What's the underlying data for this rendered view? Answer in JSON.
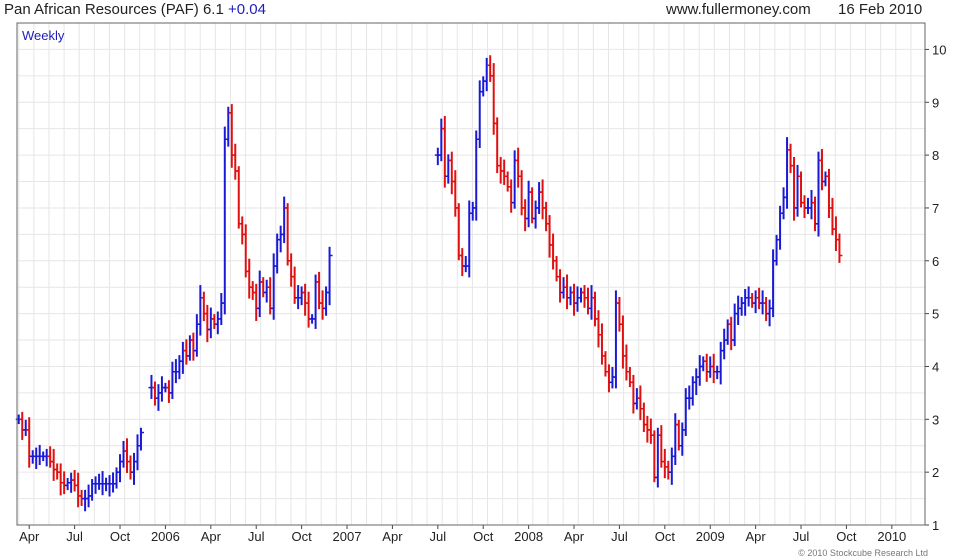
{
  "header": {
    "name": "Pan African Resources (PAF)",
    "price": "6.1",
    "change": "+0.04",
    "source": "www.fullermoney.com",
    "date": "16 Feb 2010"
  },
  "chart_data": {
    "type": "ohlc",
    "period_label": "Weekly",
    "ylim": [
      1,
      10.5
    ],
    "yticks": [
      1,
      2,
      3,
      4,
      5,
      6,
      7,
      8,
      9,
      10
    ],
    "grid": true,
    "up_color": "#1a1ad6",
    "down_color": "#e01010",
    "xticks": [
      {
        "label": "Apr",
        "x": 3
      },
      {
        "label": "Jul",
        "x": 16
      },
      {
        "label": "Oct",
        "x": 29
      },
      {
        "label": "2006",
        "x": 42
      },
      {
        "label": "Apr",
        "x": 55
      },
      {
        "label": "Jul",
        "x": 68
      },
      {
        "label": "Oct",
        "x": 81
      },
      {
        "label": "2007",
        "x": 94
      },
      {
        "label": "Apr",
        "x": 107
      },
      {
        "label": "Jul",
        "x": 120
      },
      {
        "label": "Oct",
        "x": 133
      },
      {
        "label": "2008",
        "x": 146
      },
      {
        "label": "Apr",
        "x": 159
      },
      {
        "label": "Jul",
        "x": 172
      },
      {
        "label": "Oct",
        "x": 185
      },
      {
        "label": "2009",
        "x": 198
      },
      {
        "label": "Apr",
        "x": 211
      },
      {
        "label": "Jul",
        "x": 224
      },
      {
        "label": "Oct",
        "x": 237
      },
      {
        "label": "2010",
        "x": 250
      }
    ],
    "x_range": [
      0,
      259
    ],
    "closes": [
      {
        "x": 0,
        "c": 3.0
      },
      {
        "x": 1,
        "c": 2.8
      },
      {
        "x": 2,
        "c": 2.8
      },
      {
        "x": 3,
        "c": 2.3
      },
      {
        "x": 4,
        "c": 2.3
      },
      {
        "x": 5,
        "c": 2.3
      },
      {
        "x": 6,
        "c": 2.3
      },
      {
        "x": 7,
        "c": 2.3
      },
      {
        "x": 8,
        "c": 2.3
      },
      {
        "x": 9,
        "c": 2.2
      },
      {
        "x": 10,
        "c": 2.05
      },
      {
        "x": 11,
        "c": 2.0
      },
      {
        "x": 12,
        "c": 1.8
      },
      {
        "x": 13,
        "c": 1.75
      },
      {
        "x": 14,
        "c": 1.8
      },
      {
        "x": 15,
        "c": 1.85
      },
      {
        "x": 16,
        "c": 1.75
      },
      {
        "x": 17,
        "c": 1.55
      },
      {
        "x": 18,
        "c": 1.5
      },
      {
        "x": 19,
        "c": 1.5
      },
      {
        "x": 20,
        "c": 1.55
      },
      {
        "x": 21,
        "c": 1.78
      },
      {
        "x": 22,
        "c": 1.78
      },
      {
        "x": 23,
        "c": 1.78
      },
      {
        "x": 24,
        "c": 1.78
      },
      {
        "x": 25,
        "c": 1.78
      },
      {
        "x": 26,
        "c": 1.78
      },
      {
        "x": 27,
        "c": 1.78
      },
      {
        "x": 28,
        "c": 2.0
      },
      {
        "x": 29,
        "c": 2.2
      },
      {
        "x": 30,
        "c": 2.4
      },
      {
        "x": 31,
        "c": 2.2
      },
      {
        "x": 32,
        "c": 2.0
      },
      {
        "x": 33,
        "c": 2.2
      },
      {
        "x": 34,
        "c": 2.5
      },
      {
        "x": 35,
        "c": 2.75
      },
      {
        "x": 38,
        "c": 3.6
      },
      {
        "x": 39,
        "c": 3.4
      },
      {
        "x": 40,
        "c": 3.5
      },
      {
        "x": 41,
        "c": 3.6
      },
      {
        "x": 42,
        "c": 3.6
      },
      {
        "x": 43,
        "c": 3.5
      },
      {
        "x": 44,
        "c": 3.9
      },
      {
        "x": 45,
        "c": 3.9
      },
      {
        "x": 46,
        "c": 4.1
      },
      {
        "x": 47,
        "c": 4.3
      },
      {
        "x": 48,
        "c": 4.2
      },
      {
        "x": 49,
        "c": 4.5
      },
      {
        "x": 50,
        "c": 4.3
      },
      {
        "x": 51,
        "c": 4.8
      },
      {
        "x": 52,
        "c": 5.3
      },
      {
        "x": 53,
        "c": 5.0
      },
      {
        "x": 54,
        "c": 4.7
      },
      {
        "x": 55,
        "c": 4.9
      },
      {
        "x": 56,
        "c": 4.8
      },
      {
        "x": 57,
        "c": 4.9
      },
      {
        "x": 58,
        "c": 5.2
      },
      {
        "x": 59,
        "c": 8.3
      },
      {
        "x": 60,
        "c": 8.8
      },
      {
        "x": 61,
        "c": 8.0
      },
      {
        "x": 62,
        "c": 7.7
      },
      {
        "x": 63,
        "c": 6.7
      },
      {
        "x": 64,
        "c": 6.5
      },
      {
        "x": 65,
        "c": 5.8
      },
      {
        "x": 66,
        "c": 5.5
      },
      {
        "x": 67,
        "c": 5.4
      },
      {
        "x": 68,
        "c": 5.1
      },
      {
        "x": 69,
        "c": 5.6
      },
      {
        "x": 70,
        "c": 5.4
      },
      {
        "x": 71,
        "c": 5.5
      },
      {
        "x": 72,
        "c": 5.1
      },
      {
        "x": 73,
        "c": 5.9
      },
      {
        "x": 74,
        "c": 6.4
      },
      {
        "x": 75,
        "c": 6.5
      },
      {
        "x": 76,
        "c": 7.0
      },
      {
        "x": 77,
        "c": 6.0
      },
      {
        "x": 78,
        "c": 5.7
      },
      {
        "x": 79,
        "c": 5.3
      },
      {
        "x": 80,
        "c": 5.3
      },
      {
        "x": 81,
        "c": 5.4
      },
      {
        "x": 82,
        "c": 5.2
      },
      {
        "x": 83,
        "c": 4.9
      },
      {
        "x": 84,
        "c": 4.9
      },
      {
        "x": 85,
        "c": 5.6
      },
      {
        "x": 86,
        "c": 5.2
      },
      {
        "x": 87,
        "c": 5.1
      },
      {
        "x": 88,
        "c": 5.4
      },
      {
        "x": 89,
        "c": 6.1
      },
      {
        "x": 120,
        "c": 8.0
      },
      {
        "x": 121,
        "c": 8.5
      },
      {
        "x": 122,
        "c": 7.6
      },
      {
        "x": 123,
        "c": 7.9
      },
      {
        "x": 124,
        "c": 7.5
      },
      {
        "x": 125,
        "c": 7.0
      },
      {
        "x": 126,
        "c": 6.1
      },
      {
        "x": 127,
        "c": 5.9
      },
      {
        "x": 128,
        "c": 5.9
      },
      {
        "x": 129,
        "c": 6.9
      },
      {
        "x": 130,
        "c": 7.0
      },
      {
        "x": 131,
        "c": 8.3
      },
      {
        "x": 132,
        "c": 9.2
      },
      {
        "x": 133,
        "c": 9.4
      },
      {
        "x": 134,
        "c": 9.7
      },
      {
        "x": 135,
        "c": 9.5
      },
      {
        "x": 136,
        "c": 8.6
      },
      {
        "x": 137,
        "c": 7.8
      },
      {
        "x": 138,
        "c": 7.7
      },
      {
        "x": 139,
        "c": 7.6
      },
      {
        "x": 140,
        "c": 7.4
      },
      {
        "x": 141,
        "c": 7.1
      },
      {
        "x": 142,
        "c": 7.9
      },
      {
        "x": 143,
        "c": 7.6
      },
      {
        "x": 144,
        "c": 7.0
      },
      {
        "x": 145,
        "c": 6.8
      },
      {
        "x": 146,
        "c": 7.3
      },
      {
        "x": 147,
        "c": 6.8
      },
      {
        "x": 148,
        "c": 7.0
      },
      {
        "x": 149,
        "c": 7.3
      },
      {
        "x": 150,
        "c": 7.0
      },
      {
        "x": 151,
        "c": 6.7
      },
      {
        "x": 152,
        "c": 6.3
      },
      {
        "x": 153,
        "c": 6.0
      },
      {
        "x": 154,
        "c": 5.7
      },
      {
        "x": 155,
        "c": 5.4
      },
      {
        "x": 156,
        "c": 5.5
      },
      {
        "x": 157,
        "c": 5.3
      },
      {
        "x": 158,
        "c": 5.4
      },
      {
        "x": 159,
        "c": 5.2
      },
      {
        "x": 160,
        "c": 5.3
      },
      {
        "x": 161,
        "c": 5.4
      },
      {
        "x": 162,
        "c": 5.3
      },
      {
        "x": 163,
        "c": 5.1
      },
      {
        "x": 164,
        "c": 5.3
      },
      {
        "x": 165,
        "c": 4.9
      },
      {
        "x": 166,
        "c": 4.6
      },
      {
        "x": 167,
        "c": 4.2
      },
      {
        "x": 168,
        "c": 3.9
      },
      {
        "x": 169,
        "c": 3.7
      },
      {
        "x": 170,
        "c": 3.8
      },
      {
        "x": 171,
        "c": 5.2
      },
      {
        "x": 172,
        "c": 4.8
      },
      {
        "x": 173,
        "c": 4.2
      },
      {
        "x": 174,
        "c": 3.9
      },
      {
        "x": 175,
        "c": 3.7
      },
      {
        "x": 176,
        "c": 3.3
      },
      {
        "x": 177,
        "c": 3.4
      },
      {
        "x": 178,
        "c": 3.2
      },
      {
        "x": 179,
        "c": 2.9
      },
      {
        "x": 180,
        "c": 2.8
      },
      {
        "x": 181,
        "c": 2.7
      },
      {
        "x": 182,
        "c": 1.9
      },
      {
        "x": 183,
        "c": 2.7
      },
      {
        "x": 184,
        "c": 2.2
      },
      {
        "x": 185,
        "c": 2.1
      },
      {
        "x": 186,
        "c": 2.0
      },
      {
        "x": 187,
        "c": 2.3
      },
      {
        "x": 188,
        "c": 2.9
      },
      {
        "x": 189,
        "c": 2.5
      },
      {
        "x": 190,
        "c": 2.8
      },
      {
        "x": 191,
        "c": 3.4
      },
      {
        "x": 192,
        "c": 3.4
      },
      {
        "x": 193,
        "c": 3.7
      },
      {
        "x": 194,
        "c": 3.8
      },
      {
        "x": 195,
        "c": 4.0
      },
      {
        "x": 196,
        "c": 4.1
      },
      {
        "x": 197,
        "c": 3.9
      },
      {
        "x": 198,
        "c": 4.0
      },
      {
        "x": 199,
        "c": 3.9
      },
      {
        "x": 200,
        "c": 3.9
      },
      {
        "x": 201,
        "c": 4.3
      },
      {
        "x": 202,
        "c": 4.5
      },
      {
        "x": 203,
        "c": 4.8
      },
      {
        "x": 204,
        "c": 4.5
      },
      {
        "x": 205,
        "c": 5.0
      },
      {
        "x": 206,
        "c": 5.1
      },
      {
        "x": 207,
        "c": 5.2
      },
      {
        "x": 208,
        "c": 5.3
      },
      {
        "x": 209,
        "c": 5.3
      },
      {
        "x": 210,
        "c": 5.2
      },
      {
        "x": 211,
        "c": 5.3
      },
      {
        "x": 212,
        "c": 5.2
      },
      {
        "x": 213,
        "c": 5.2
      },
      {
        "x": 214,
        "c": 5.0
      },
      {
        "x": 215,
        "c": 5.1
      },
      {
        "x": 216,
        "c": 6.0
      },
      {
        "x": 217,
        "c": 6.4
      },
      {
        "x": 218,
        "c": 6.9
      },
      {
        "x": 219,
        "c": 7.2
      },
      {
        "x": 220,
        "c": 8.1
      },
      {
        "x": 221,
        "c": 7.8
      },
      {
        "x": 222,
        "c": 7.0
      },
      {
        "x": 223,
        "c": 7.6
      },
      {
        "x": 224,
        "c": 7.1
      },
      {
        "x": 225,
        "c": 7.0
      },
      {
        "x": 226,
        "c": 7.0
      },
      {
        "x": 227,
        "c": 7.1
      },
      {
        "x": 228,
        "c": 6.7
      },
      {
        "x": 229,
        "c": 7.9
      },
      {
        "x": 230,
        "c": 7.5
      },
      {
        "x": 231,
        "c": 7.6
      },
      {
        "x": 232,
        "c": 7.0
      },
      {
        "x": 233,
        "c": 6.6
      },
      {
        "x": 234,
        "c": 6.4
      },
      {
        "x": 235,
        "c": 6.1
      }
    ]
  }
}
